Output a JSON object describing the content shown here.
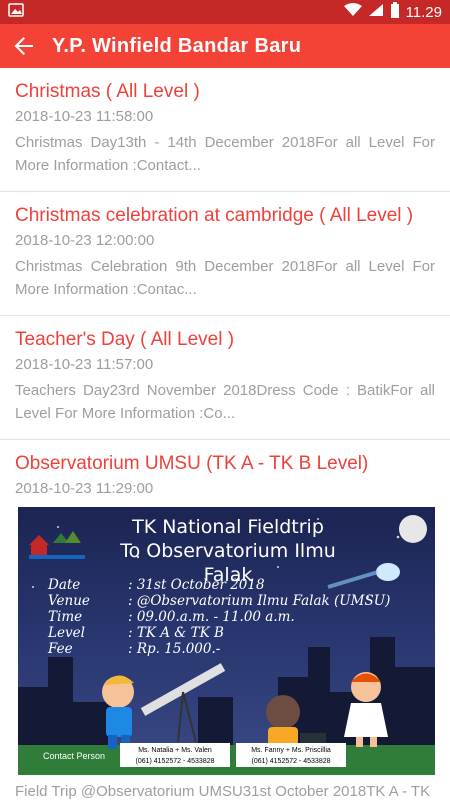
{
  "status": {
    "time": "11.29"
  },
  "app": {
    "title": "Y.P. Winfield Bandar Baru"
  },
  "posts": [
    {
      "title": "Christmas ( All Level )",
      "date": "2018-10-23 11:58:00",
      "excerpt": "Christmas Day13th  - 14th December 2018For all Level For More Information :Contact..."
    },
    {
      "title": "Christmas celebration at cambridge ( All Level )",
      "date": "2018-10-23 12:00:00",
      "excerpt": "Christmas Celebration 9th  December 2018For all Level For More Information :Contac..."
    },
    {
      "title": "Teacher's Day ( All Level )",
      "date": "2018-10-23 11:57:00",
      "excerpt": "Teachers Day23rd November  2018Dress Code : BatikFor all Level For More Information :Co..."
    },
    {
      "title": "Observatorium UMSU (TK A - TK B Level)",
      "date": "2018-10-23 11:29:00",
      "excerpt": "Field Trip @Observatorium UMSU31st October 2018TK A - TK"
    }
  ],
  "poster": {
    "heading1": "TK National Fieldtrip",
    "heading2": "To Observatorium Ilmu Falak",
    "rows": [
      {
        "key": "Date",
        "value": ": 31st October 2018"
      },
      {
        "key": "Venue",
        "value": ": @Observatorium Ilmu Falak (UMSU)"
      },
      {
        "key": "Time",
        "value": ": 09.00.a.m. - 11.00 a.m."
      },
      {
        "key": "Level",
        "value": ": TK A & TK B"
      },
      {
        "key": "Fee",
        "value": ": Rp. 15.000.-"
      }
    ],
    "contact_label": "Contact Person",
    "contact1_names": "Ms. Natalia + Ms. Valen",
    "contact1_phone": "(061) 4152572 - 4533828",
    "contact2_names": "Ms. Fanny + Ms. Priscillia",
    "contact2_phone": "(061) 4152572 - 4533828"
  },
  "colors": {
    "appbar": "#f44336",
    "statusbar": "#c62828",
    "title": "#f0403a",
    "muted": "#9e9e9e"
  }
}
